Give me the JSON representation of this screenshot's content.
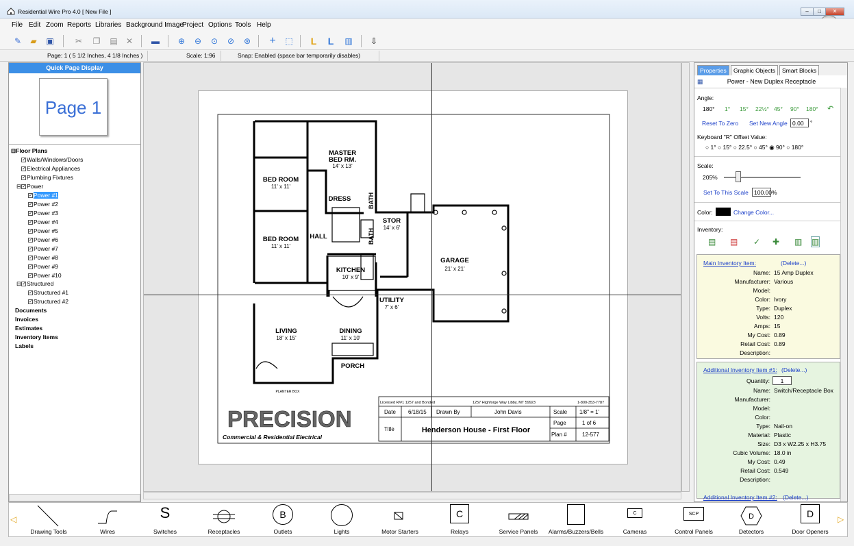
{
  "window": {
    "title": "Residential Wire Pro 4.0  [ New File ]"
  },
  "menu": [
    "File",
    "Edit",
    "Zoom",
    "Reports",
    "Libraries",
    "Background Image",
    "Project",
    "Options",
    "Tools",
    "Help"
  ],
  "status": {
    "page": "Page: 1   ( 5 1/2 Inches, 4 1/8 Inches )",
    "scale": "Scale: 1:96",
    "snap": "Snap: Enabled  (space bar temporarily disables)"
  },
  "left": {
    "header": "Quick Page Display",
    "thumb": "Page 1",
    "tree": {
      "floor": "Floor Plans",
      "walls": "Walls/Windows/Doors",
      "elec": "Electrical Appliances",
      "plumb": "Plumbing Fixtures",
      "power": "Power",
      "p": [
        "Power #1",
        "Power #2",
        "Power #3",
        "Power #4",
        "Power #5",
        "Power #6",
        "Power #7",
        "Power #8",
        "Power #9",
        "Power #10"
      ],
      "structured": "Structured",
      "s": [
        "Structured #1",
        "Structured #2"
      ],
      "documents": "Documents",
      "invoices": "Invoices",
      "estimates": "Estimates",
      "inventory": "Inventory Items",
      "labels": "Labels"
    }
  },
  "plan": {
    "rooms": {
      "master": "MASTER",
      "bedrm": "BED RM.",
      "master_size": "14' x 13'",
      "bed1": "BED ROOM",
      "bed1_size": "11' x 11'",
      "bed2": "BED ROOM",
      "bed2_size": "11' x 11'",
      "dress": "DRESS",
      "bath1": "BATH",
      "bath2": "BATH",
      "hall": "HALL",
      "stor": "STOR",
      "stor_size": "14' x 6'",
      "kitchen": "KITCHEN",
      "kitchen_size": "10' x 9'",
      "garage": "GARAGE",
      "garage_size": "21' x 21'",
      "utility": "UTILITY",
      "utility_size": "7' x 6'",
      "living": "LIVING",
      "living_size": "18' x 15'",
      "dining": "DINING",
      "dining_size": "11' x 10'",
      "porch": "PORCH",
      "planter": "PLANTER BOX"
    },
    "logo": "PRECISION",
    "tagline": "Commercial & Residential Electrical",
    "tb": {
      "license": "Licensed R/#1 1257 and Bonded",
      "address": "1257 Highforge Way  Libby, MT 59923",
      "phone": "1-800-353-7787",
      "date_l": "Date",
      "date": "6/18/15",
      "drawn_l": "Drawn By",
      "drawn": "John Davis",
      "scale_l": "Scale",
      "scale": "1/8\" = 1'",
      "title_l": "Title",
      "title": "Henderson House - First Floor",
      "page_l": "Page",
      "page": "1 of 6",
      "plan_l": "Plan #",
      "plan": "12-577"
    }
  },
  "right": {
    "tabs": [
      "Properties",
      "Graphic Objects",
      "Smart Blocks"
    ],
    "item": "Power - New Duplex Receptacle",
    "angle_l": "Angle:",
    "angle": "180°",
    "angles": [
      "1°",
      "15°",
      "22½°",
      "45°",
      "90°",
      "180°"
    ],
    "reset": "Reset To Zero",
    "setnew": "Set New Angle",
    "newangle": "0.00",
    "deg": "°",
    "offset_l": "Keyboard \"R\" Offset Value:",
    "offsets": "○ 1°  ○ 15°  ○ 22.5°  ○ 45°  ◉ 90°  ○ 180°",
    "scale_l": "Scale:",
    "scale": "205%",
    "setscale": "Set To This Scale",
    "scaleval": "100.00",
    "pct": "%",
    "color_l": "Color:",
    "change": "Change Color...",
    "inv_l": "Inventory:",
    "main": {
      "title": "Main Inventory Item:",
      "del": "(Delete...)",
      "labels": [
        "Name:",
        "Manufacturer:",
        "Model:",
        "Color:",
        "Type:",
        "Volts:",
        "Amps:",
        "My Cost:",
        "Retail Cost:",
        "Description:"
      ],
      "values": [
        "15 Amp Duplex",
        "Various",
        "",
        "Ivory",
        "Duplex",
        "120",
        "15",
        "0.89",
        "0.89",
        ""
      ]
    },
    "add1": {
      "title": "Additional Inventory Item #1:",
      "del": "(Delete...)",
      "qty_l": "Quantity:",
      "qty": "1",
      "labels": [
        "Name:",
        "Manufacturer:",
        "Model:",
        "Color:",
        "Type:",
        "Material:",
        "Size:",
        "Cubic Volume:",
        "My Cost:",
        "Retail Cost:",
        "Description:"
      ],
      "values": [
        "Switch/Receptacle Box",
        "",
        "",
        "",
        "Nail-on",
        "Plastic",
        "D3 x W2.25 x H3.75",
        "18.0 in",
        "0.49",
        "0.549",
        ""
      ]
    },
    "add2": {
      "title": "Additional Inventory Item #2:",
      "del": "(Delete...)"
    }
  },
  "bottom": [
    "Drawing Tools",
    "Wires",
    "Switches",
    "Receptacles",
    "Outlets",
    "Lights",
    "Motor Starters",
    "Relays",
    "Service Panels",
    "Alarms/Buzzers/Bells",
    "Cameras",
    "Control Panels",
    "Detectors",
    "Door Openers"
  ],
  "bottom_glyphs": {
    "switches": "S",
    "outlets": "B",
    "relays": "C",
    "detectors": "D",
    "dooropeners": "D",
    "control": "SCP",
    "cameras": "C"
  }
}
